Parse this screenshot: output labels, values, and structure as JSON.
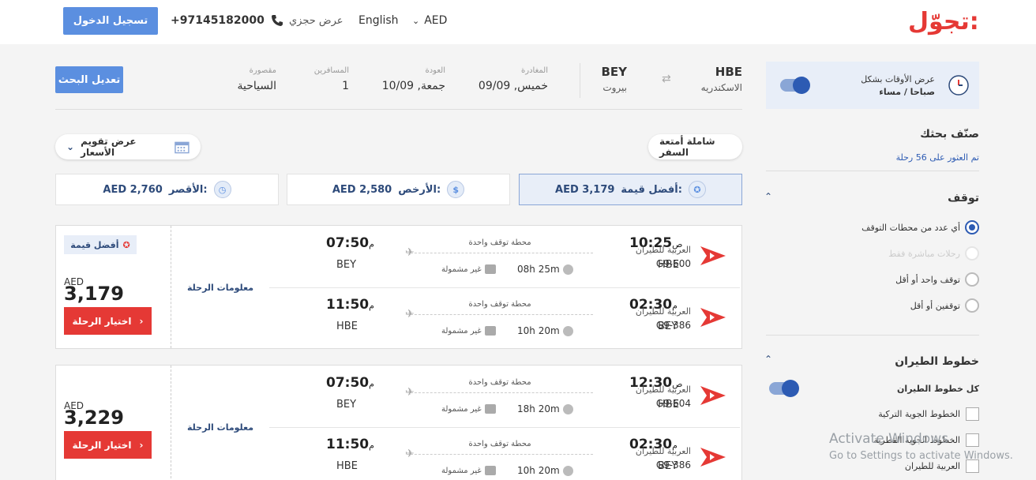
{
  "header": {
    "logo": "تجوّل:",
    "currency": "AED",
    "language": "English",
    "my_booking": "عرض حجزي",
    "phone": "+97145182000",
    "login": "تسجيل الدخول"
  },
  "search": {
    "from_code": "HBE",
    "from_city": "الاسكندريه",
    "to_code": "BEY",
    "to_city": "بيروت",
    "depart_label": "المغادرة",
    "depart_value": "خميس, 09/09",
    "return_label": "العودة",
    "return_value": "جمعة, 10/09",
    "pax_label": "المسافرين",
    "pax_value": "1",
    "class_label": "مقصورة",
    "class_value": "السياحية",
    "edit_button": "تعديل البحث"
  },
  "filters_bar": {
    "baggage_pill": "شاملة أمتعة السفر",
    "calendar_pill": "عرض تقويم الأسعار"
  },
  "sort_tabs": [
    {
      "label": "أفضل قيمة:",
      "price": "AED 3,179",
      "icon": "medal-icon",
      "active": true
    },
    {
      "label": "الأرخص:",
      "price": "AED 2,580",
      "icon": "money-icon",
      "active": false
    },
    {
      "label": "الأقصر:",
      "price": "AED 2,760",
      "icon": "stopwatch-icon",
      "active": false
    }
  ],
  "results": [
    {
      "badge": "أفضل قيمة",
      "currency": "AED",
      "price": "3,179",
      "select": "اختيار الرحلة",
      "info": "معلومات الرحلة",
      "legs": [
        {
          "airline": "العربية للطيران",
          "flight": "G9-600",
          "dep_time": "10:25",
          "dep_suffix": "ص",
          "dep_code": "HBE",
          "arr_time": "07:50",
          "arr_suffix": "م",
          "arr_code": "BEY",
          "stops": "محطة توقف واحدة",
          "duration": "08h 25m",
          "baggage": "غير مشمولة"
        },
        {
          "airline": "العربية للطيران",
          "flight": "G9-386",
          "dep_time": "02:30",
          "dep_suffix": "م",
          "dep_code": "BEY",
          "arr_time": "11:50",
          "arr_suffix": "م",
          "arr_code": "HBE",
          "stops": "محطة توقف واحدة",
          "duration": "10h 20m",
          "baggage": "غير مشمولة"
        }
      ]
    },
    {
      "badge": "",
      "currency": "AED",
      "price": "3,229",
      "select": "اختيار الرحلة",
      "info": "معلومات الرحلة",
      "legs": [
        {
          "airline": "العربية للطيران",
          "flight": "G9-604",
          "dep_time": "12:30",
          "dep_suffix": "ص",
          "dep_code": "HBE",
          "arr_time": "07:50",
          "arr_suffix": "م",
          "arr_code": "BEY",
          "stops": "محطة توقف واحدة",
          "duration": "18h 20m",
          "baggage": "غير مشمولة"
        },
        {
          "airline": "العربية للطيران",
          "flight": "G9-386",
          "dep_time": "02:30",
          "dep_suffix": "م",
          "dep_code": "BEY",
          "arr_time": "11:50",
          "arr_suffix": "م",
          "arr_code": "HBE",
          "stops": "محطة توقف واحدة",
          "duration": "10h 20m",
          "baggage": "غير مشمولة"
        }
      ]
    }
  ],
  "sidebar": {
    "time_format_label": "عرض الأوقات بشكل",
    "time_format_value": "صباحا / مساء",
    "sort_title": "صنّف بحثك",
    "found": "تم العثور على 56 رحلة",
    "stops_title": "توقف",
    "stop_options": [
      {
        "label": "أي عدد من محطات التوقف",
        "state": "on"
      },
      {
        "label": "رحلات مباشرة فقط",
        "state": "disabled"
      },
      {
        "label": "توقف واحد أو أقل",
        "state": "off"
      },
      {
        "label": "توقفين أو أقل",
        "state": "off"
      }
    ],
    "airlines_title": "خطوط الطيران",
    "all_airlines": "كل خطوط الطيران",
    "airlines": [
      "الخطوط الجوية التركية",
      "الخطوط الجوية القطرية",
      "العربية للطيران"
    ]
  },
  "watermark": {
    "line1": "Activate Windows",
    "line2": "Go to Settings to activate Windows."
  },
  "colors": {
    "accent": "#5b8fe0",
    "brand": "#e53935",
    "navy": "#2d4a7a"
  }
}
